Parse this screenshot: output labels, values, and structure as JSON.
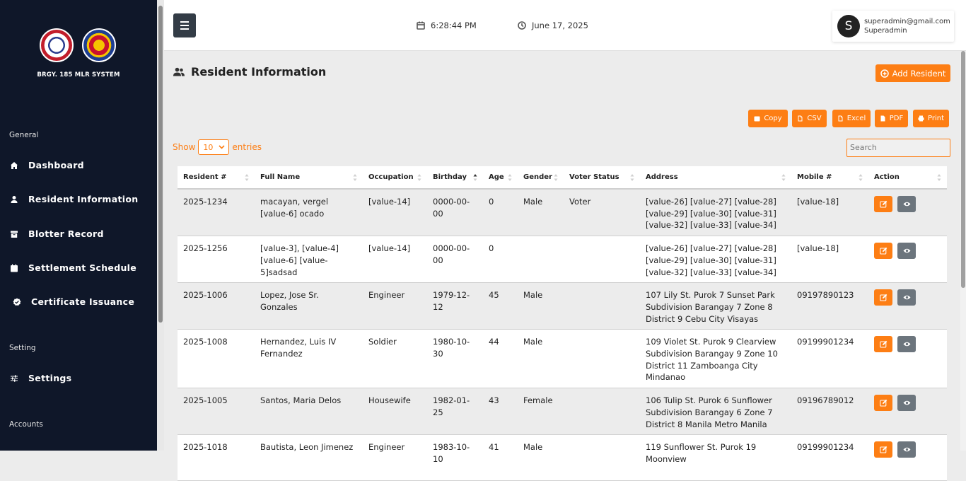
{
  "sidebar": {
    "brand": "BRGY. 185 MLR SYSTEM",
    "sections": {
      "general": "General",
      "setting": "Setting",
      "accounts": "Accounts"
    },
    "items": [
      {
        "label": "Dashboard",
        "icon": "home-icon"
      },
      {
        "label": "Resident Information",
        "icon": "user-icon"
      },
      {
        "label": "Blotter Record",
        "icon": "archive-icon"
      },
      {
        "label": "Settlement Schedule",
        "icon": "calendar-icon"
      },
      {
        "label": "Certificate Issuance",
        "icon": "badge-check-icon"
      },
      {
        "label": "Settings",
        "icon": "sliders-icon"
      }
    ]
  },
  "topbar": {
    "time": "6:28:44 PM",
    "date": "June 17, 2025",
    "user": {
      "initial": "S",
      "email": "superadmin@gmail.com",
      "role": "Superadmin"
    }
  },
  "page": {
    "title": "Resident Information",
    "add_label": "Add Resident",
    "export_buttons": [
      "Copy",
      "CSV",
      "Excel",
      "PDF",
      "Print"
    ],
    "show_label": "Show",
    "entries_value": "10",
    "entries_label": "entries",
    "search_placeholder": "Search"
  },
  "table": {
    "columns": [
      "Resident #",
      "Full Name",
      "Occupation",
      "Birthday",
      "Age",
      "Gender",
      "Voter Status",
      "Address",
      "Mobile #",
      "Action"
    ],
    "rows": [
      [
        "2025-1234",
        "macayan, vergel [value-6] ocado",
        "[value-14]",
        "0000-00-00",
        "0",
        "Male",
        "Voter",
        "[value-26] [value-27] [value-28] [value-29] [value-30] [value-31] [value-32] [value-33] [value-34]",
        "[value-18]"
      ],
      [
        "2025-1256",
        "[value-3], [value-4] [value-6] [value-5]sadsad",
        "[value-14]",
        "0000-00-00",
        "0",
        "",
        "",
        "[value-26] [value-27] [value-28] [value-29] [value-30] [value-31] [value-32] [value-33] [value-34]",
        "[value-18]"
      ],
      [
        "2025-1006",
        "Lopez, Jose Sr. Gonzales",
        "Engineer",
        "1979-12-12",
        "45",
        "Male",
        "",
        "107 Lily St. Purok 7 Sunset Park Subdivision Barangay 7 Zone 8 District 9 Cebu City Visayas",
        "09197890123"
      ],
      [
        "2025-1008",
        "Hernandez, Luis IV Fernandez",
        "Soldier",
        "1980-10-30",
        "44",
        "Male",
        "",
        "109 Violet St. Purok 9 Clearview Subdivision Barangay 9 Zone 10 District 11 Zamboanga City Mindanao",
        "09199901234"
      ],
      [
        "2025-1005",
        "Santos, Maria Delos",
        "Housewife",
        "1982-01-25",
        "43",
        "Female",
        "",
        "106 Tulip St. Purok 6 Sunflower Subdivision Barangay 6 Zone 7 District 8 Manila Metro Manila",
        "09196789012"
      ],
      [
        "2025-1018",
        "Bautista, Leon Jimenez",
        "Engineer",
        "1983-10-10",
        "41",
        "Male",
        "",
        "119 Sunflower St. Purok 19 Moonview",
        "09199901234"
      ]
    ]
  }
}
